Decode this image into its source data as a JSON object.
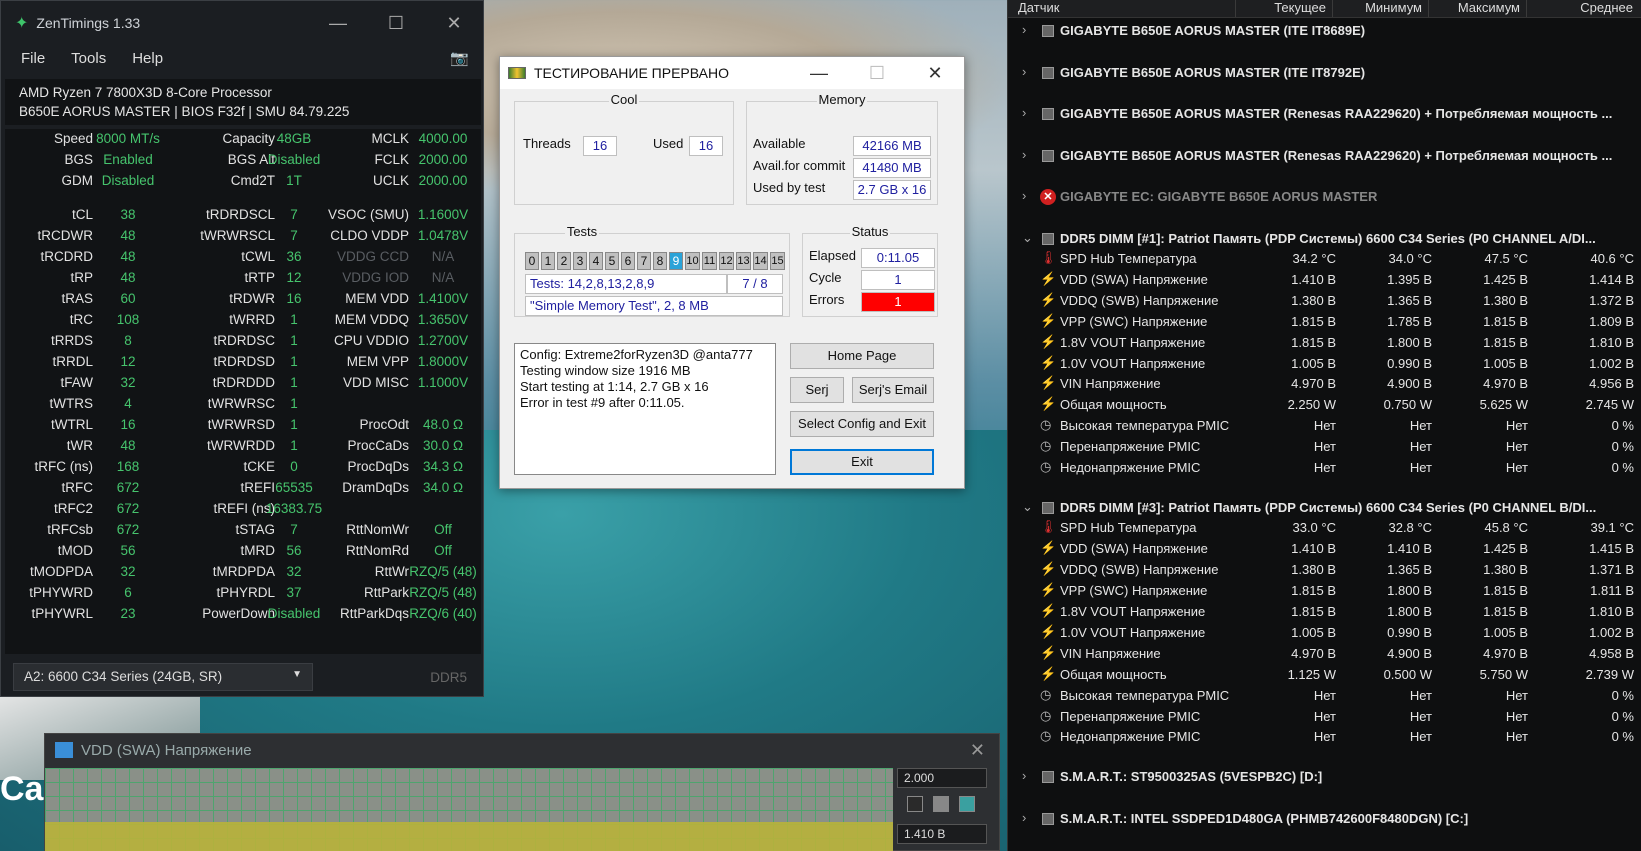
{
  "zentimings": {
    "title": "ZenTimings 1.33",
    "menu": [
      "File",
      "Tools",
      "Help"
    ],
    "cpu": "AMD Ryzen 7 7800X3D 8-Core Processor",
    "board": "B650E AORUS MASTER | BIOS F32f | SMU 84.79.225",
    "rows": [
      [
        "Speed",
        "8000 MT/s",
        "Capacity",
        "48GB",
        "MCLK",
        "4000.00"
      ],
      [
        "BGS",
        "Enabled",
        "BGS Alt",
        "Disabled",
        "FCLK",
        "2000.00"
      ],
      [
        "GDM",
        "Disabled",
        "Cmd2T",
        "1T",
        "UCLK",
        "2000.00"
      ],
      [
        "tCL",
        "38",
        "tRDRDSCL",
        "7",
        "VSOC (SMU)",
        "1.1600V"
      ],
      [
        "tRCDWR",
        "48",
        "tWRWRSCL",
        "7",
        "CLDO VDDP",
        "1.0478V"
      ],
      [
        "tRCDRD",
        "48",
        "tCWL",
        "36",
        "VDDG CCD",
        "N/A"
      ],
      [
        "tRP",
        "48",
        "tRTP",
        "12",
        "VDDG IOD",
        "N/A"
      ],
      [
        "tRAS",
        "60",
        "tRDWR",
        "16",
        "MEM VDD",
        "1.4100V"
      ],
      [
        "tRC",
        "108",
        "tWRRD",
        "1",
        "MEM VDDQ",
        "1.3650V"
      ],
      [
        "tRRDS",
        "8",
        "tRDRDSC",
        "1",
        "CPU VDDIO",
        "1.2700V"
      ],
      [
        "tRRDL",
        "12",
        "tRDRDSD",
        "1",
        "MEM VPP",
        "1.8000V"
      ],
      [
        "tFAW",
        "32",
        "tRDRDDD",
        "1",
        "VDD MISC",
        "1.1000V"
      ],
      [
        "tWTRS",
        "4",
        "tWRWRSC",
        "1",
        "",
        ""
      ],
      [
        "tWTRL",
        "16",
        "tWRWRSD",
        "1",
        "ProcOdt",
        "48.0 Ω"
      ],
      [
        "tWR",
        "48",
        "tWRWRDD",
        "1",
        "ProcCaDs",
        "30.0 Ω"
      ],
      [
        "tRFC (ns)",
        "168",
        "tCKE",
        "0",
        "ProcDqDs",
        "34.3 Ω"
      ],
      [
        "tRFC",
        "672",
        "tREFI",
        "65535",
        "DramDqDs",
        "34.0 Ω"
      ],
      [
        "tRFC2",
        "672",
        "tREFI (ns)",
        "16383.75",
        "",
        ""
      ],
      [
        "tRFCsb",
        "672",
        "tSTAG",
        "7",
        "RttNomWr",
        "Off"
      ],
      [
        "tMOD",
        "56",
        "tMRD",
        "56",
        "RttNomRd",
        "Off"
      ],
      [
        "tMODPDA",
        "32",
        "tMRDPDA",
        "32",
        "RttWr",
        "RZQ/5 (48)"
      ],
      [
        "tPHYWRD",
        "6",
        "tPHYRDL",
        "37",
        "RttPark",
        "RZQ/5 (48)"
      ],
      [
        "tPHYWRL",
        "23",
        "PowerDown",
        "Disabled",
        "RttParkDqs",
        "RZQ/6 (40)"
      ]
    ],
    "module": "A2: 6600 C34 Series (24GB, SR)",
    "ddr": "DDR5"
  },
  "testmem": {
    "title": "ТЕСТИРОВАНИЕ ПРЕРВАНО",
    "cool": {
      "label": "Cool",
      "threads_label": "Threads",
      "threads": "16",
      "used_label": "Used",
      "used": "16"
    },
    "memory": {
      "label": "Memory",
      "available_label": "Available",
      "available": "42166 MB",
      "commit_label": "Avail.for commit",
      "commit": "41480 MB",
      "used_label": "Used by test",
      "used": "2.7 GB x 16"
    },
    "tests": {
      "label": "Tests",
      "cells": [
        "0",
        "1",
        "2",
        "3",
        "4",
        "5",
        "6",
        "7",
        "8",
        "9",
        "10",
        "11",
        "12",
        "13",
        "14",
        "15"
      ],
      "active": 9,
      "sequence": "Tests: 14,2,8,13,2,8,9",
      "progress": "7 / 8",
      "current": "\"Simple Memory Test\", 2, 8 MB"
    },
    "status": {
      "label": "Status",
      "elapsed_label": "Elapsed",
      "elapsed": "0:11.05",
      "cycle_label": "Cycle",
      "cycle": "1",
      "errors_label": "Errors",
      "errors": "1"
    },
    "log": [
      "Config: Extreme2forRyzen3D @anta777",
      "Testing window size 1916 MB",
      "Start testing at 1:14, 2.7 GB x 16",
      "Error in test #9 after 0:11.05."
    ],
    "buttons": {
      "home": "Home Page",
      "serj": "Serj",
      "email": "Serj's Email",
      "select": "Select Config and Exit",
      "exit": "Exit"
    }
  },
  "hwinfo": {
    "headers": [
      "Датчик",
      "Текущее",
      "Минимум",
      "Максимум",
      "Среднее"
    ],
    "groups": [
      {
        "name": "GIGABYTE B650E AORUS MASTER (ITE IT8689E)",
        "type": "chip",
        "exp": "›"
      },
      {
        "name": "GIGABYTE B650E AORUS MASTER (ITE IT8792E)",
        "type": "chip",
        "exp": "›"
      },
      {
        "name": "GIGABYTE B650E AORUS MASTER (Renesas RAA229620) + Потребляемая мощность ...",
        "type": "chip",
        "exp": "›"
      },
      {
        "name": "GIGABYTE B650E AORUS MASTER (Renesas RAA229620) + Потребляемая мощность ...",
        "type": "chip",
        "exp": "›"
      },
      {
        "name": "GIGABYTE EC: GIGABYTE B650E AORUS MASTER",
        "type": "err",
        "exp": "›"
      },
      {
        "name": "DDR5 DIMM [#1]: Patriot Память (PDP Системы) 6600 C34 Series (P0 CHANNEL A/DI...",
        "type": "chip",
        "exp": "⌄",
        "rows": [
          [
            "t",
            "SPD Hub Температура",
            "34.2 °C",
            "34.0 °C",
            "47.5 °C",
            "40.6 °C"
          ],
          [
            "v",
            "VDD (SWA) Напряжение",
            "1.410 В",
            "1.395 В",
            "1.425 В",
            "1.414 В"
          ],
          [
            "v",
            "VDDQ (SWB) Напряжение",
            "1.380 В",
            "1.365 В",
            "1.380 В",
            "1.372 В"
          ],
          [
            "v",
            "VPP (SWC) Напряжение",
            "1.815 В",
            "1.785 В",
            "1.815 В",
            "1.809 В"
          ],
          [
            "v",
            "1.8V VOUT Напряжение",
            "1.815 В",
            "1.800 В",
            "1.815 В",
            "1.810 В"
          ],
          [
            "v",
            "1.0V VOUT Напряжение",
            "1.005 В",
            "0.990 В",
            "1.005 В",
            "1.002 В"
          ],
          [
            "v",
            "VIN Напряжение",
            "4.970 В",
            "4.900 В",
            "4.970 В",
            "4.956 В"
          ],
          [
            "v",
            "Общая мощность",
            "2.250 W",
            "0.750 W",
            "5.625 W",
            "2.745 W"
          ],
          [
            "c",
            "Высокая температура PMIC",
            "Нет",
            "Нет",
            "Нет",
            "0 %"
          ],
          [
            "c",
            "Перенапряжение PMIC",
            "Нет",
            "Нет",
            "Нет",
            "0 %"
          ],
          [
            "c",
            "Недонапряжение PMIC",
            "Нет",
            "Нет",
            "Нет",
            "0 %"
          ]
        ]
      },
      {
        "name": "DDR5 DIMM [#3]: Patriot Память (PDP Системы) 6600 C34 Series (P0 CHANNEL B/DI...",
        "type": "chip",
        "exp": "⌄",
        "rows": [
          [
            "t",
            "SPD Hub Температура",
            "33.0 °C",
            "32.8 °C",
            "45.8 °C",
            "39.1 °C"
          ],
          [
            "v",
            "VDD (SWA) Напряжение",
            "1.410 В",
            "1.410 В",
            "1.425 В",
            "1.415 В"
          ],
          [
            "v",
            "VDDQ (SWB) Напряжение",
            "1.380 В",
            "1.365 В",
            "1.380 В",
            "1.371 В"
          ],
          [
            "v",
            "VPP (SWC) Напряжение",
            "1.815 В",
            "1.800 В",
            "1.815 В",
            "1.811 В"
          ],
          [
            "v",
            "1.8V VOUT Напряжение",
            "1.815 В",
            "1.800 В",
            "1.815 В",
            "1.810 В"
          ],
          [
            "v",
            "1.0V VOUT Напряжение",
            "1.005 В",
            "0.990 В",
            "1.005 В",
            "1.002 В"
          ],
          [
            "v",
            "VIN Напряжение",
            "4.970 В",
            "4.900 В",
            "4.970 В",
            "4.958 В"
          ],
          [
            "v",
            "Общая мощность",
            "1.125 W",
            "0.500 W",
            "5.750 W",
            "2.739 W"
          ],
          [
            "c",
            "Высокая температура PMIC",
            "Нет",
            "Нет",
            "Нет",
            "0 %"
          ],
          [
            "c",
            "Перенапряжение PMIC",
            "Нет",
            "Нет",
            "Нет",
            "0 %"
          ],
          [
            "c",
            "Недонапряжение PMIC",
            "Нет",
            "Нет",
            "Нет",
            "0 %"
          ]
        ]
      },
      {
        "name": "S.M.A.R.T.: ST9500325AS (5VESPB2C) [D:]",
        "type": "chip",
        "exp": "›"
      },
      {
        "name": "S.M.A.R.T.: INTEL SSDPED1D480GA (PHMB742600F8480DGN) [C:]",
        "type": "chip",
        "exp": "›"
      }
    ]
  },
  "graph": {
    "title": "VDD (SWA) Напряжение",
    "max": "2.000",
    "current": "1.410 В",
    "swatches": [
      "#2a2a2a",
      "#888888",
      "#3aa0a0"
    ]
  },
  "desktop": {
    "text": "Cal"
  }
}
